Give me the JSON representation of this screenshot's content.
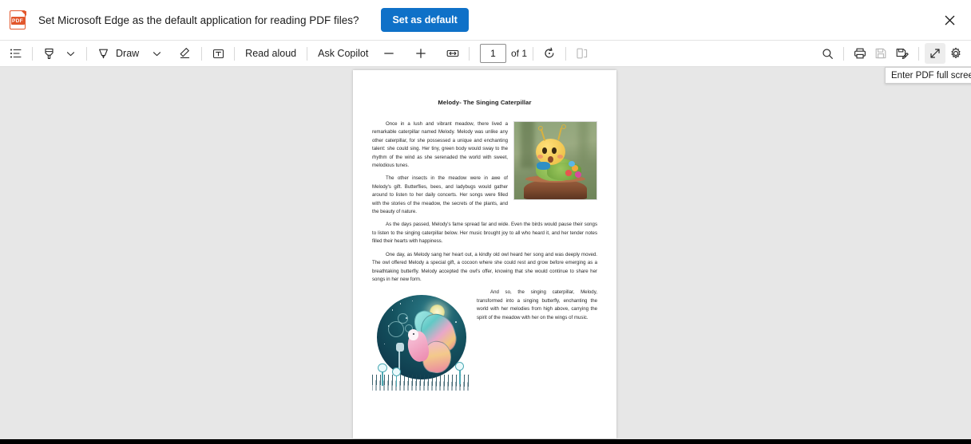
{
  "notification": {
    "icon": "pdf-file-icon",
    "message": "Set Microsoft Edge as the default application for reading PDF files?",
    "primary_button": "Set as default",
    "close_icon": "close-icon",
    "button_color": "#0f71c8"
  },
  "toolbar": {
    "toc_icon": "table-of-contents-icon",
    "highlight_icon": "highlighter-icon",
    "highlight_chevron_icon": "chevron-down-icon",
    "draw_icon": "draw-pen-icon",
    "draw_label": "Draw",
    "draw_chevron_icon": "chevron-down-icon",
    "erase_icon": "eraser-icon",
    "text_icon": "add-text-icon",
    "read_aloud_label": "Read aloud",
    "ask_copilot_label": "Ask Copilot",
    "zoom_out_icon": "zoom-out-icon",
    "zoom_in_icon": "zoom-in-icon",
    "fit_page_icon": "fit-to-width-icon",
    "page_number_value": "1",
    "page_number_placeholder": "1",
    "page_total_label": "of 1",
    "rotate_icon": "rotate-icon",
    "page_layout_icon": "page-view-icon",
    "search_icon": "search-icon",
    "print_icon": "print-icon",
    "save_icon": "save-icon",
    "save_as_icon": "save-as-icon",
    "fullscreen_icon": "enter-fullscreen-icon",
    "settings_icon": "gear-icon"
  },
  "tooltip": {
    "text": "Enter PDF full screen"
  },
  "document": {
    "title": "Melody- The Singing Caterpillar",
    "image_1": "caterpillar-photo",
    "image_2": "singing-butterfly-illustration",
    "paragraphs": [
      "Once in a lush and vibrant meadow, there lived a remarkable caterpillar named Melody. Melody was unlike any other caterpillar, for she possessed a unique and enchanting talent: she could sing. Her tiny, green body would sway to the rhythm of the wind as she serenaded the world with sweet, melodious tunes.",
      "The other insects in the meadow were in awe of Melody's gift. Butterflies, bees, and ladybugs would gather around to listen to her daily concerts. Her songs were filled with the stories of the meadow, the secrets of the plants, and the beauty of nature.",
      "As the days passed, Melody's fame spread far and wide. Even the birds would pause their songs to listen to the singing caterpillar below. Her music brought joy to all who heard it, and her tender notes filled their hearts with happiness.",
      "One day, as Melody sang her heart out, a kindly old owl heard her song and was deeply moved. The owl offered Melody a special gift, a cocoon where she could rest and grow before emerging as a breathtaking butterfly. Melody accepted the owl's offer, knowing that she would continue to share her songs in her new form.",
      "And so, the singing caterpillar, Melody, transformed into a singing butterfly, enchanting the world with her melodies from high above, carrying the spirit of the meadow with her on the wings of music."
    ]
  },
  "viewer": {
    "background_color": "#e7e7e7",
    "page_background_color": "#ffffff"
  }
}
